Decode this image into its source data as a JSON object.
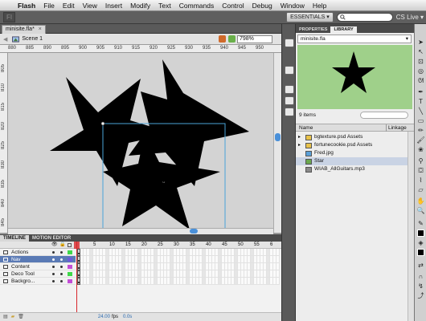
{
  "menubar": {
    "app": "Flash",
    "items": [
      "File",
      "Edit",
      "View",
      "Insert",
      "Modify",
      "Text",
      "Commands",
      "Control",
      "Debug",
      "Window",
      "Help"
    ]
  },
  "apptoolbar": {
    "logo": "Fl",
    "workspace": "ESSENTIALS ▾",
    "search_placeholder": "",
    "cslive": "CS Live ▾"
  },
  "document": {
    "tab": "minisite.fla*",
    "scene": "Scene 1",
    "zoom": "798%"
  },
  "rulers": {
    "h": [
      "880",
      "885",
      "890",
      "895",
      "900",
      "905",
      "910",
      "915",
      "920",
      "925",
      "930",
      "935",
      "940",
      "945",
      "950"
    ],
    "v": [
      "805",
      "810",
      "815",
      "820",
      "825",
      "830",
      "835",
      "840",
      "845"
    ]
  },
  "timeline": {
    "tabs": [
      "TIMELINE",
      "MOTION EDITOR"
    ],
    "frame_numbers": [
      "5",
      "10",
      "15",
      "20",
      "25",
      "30",
      "35",
      "40",
      "45",
      "50",
      "55",
      "6"
    ],
    "layers": [
      {
        "name": "Actions",
        "color": "#3fd84a",
        "selected": false
      },
      {
        "name": "Nav",
        "color": "#6a5bd8",
        "selected": true
      },
      {
        "name": "Content",
        "color": "#c24dd6",
        "selected": false
      },
      {
        "name": "Deco Tool",
        "color": "#3fd84a",
        "selected": false
      },
      {
        "name": "Backgro...",
        "color": "#c24dd6",
        "selected": false
      }
    ],
    "fps": "24.00",
    "fps_label": "fps",
    "time": "0.0s"
  },
  "panel": {
    "tabs": [
      "PROPERTIES",
      "LIBRARY"
    ],
    "library_file": "minisite.fla",
    "item_count": "9 items",
    "col_name": "Name",
    "col_linkage": "Linkage",
    "items": [
      {
        "name": "bgtexture.psd Assets",
        "type": "folder"
      },
      {
        "name": "fortunecookie.psd Assets",
        "type": "folder"
      },
      {
        "name": "Fred.jpg",
        "type": "bitmap"
      },
      {
        "name": "Star",
        "type": "symbol"
      },
      {
        "name": "WIAB_AllGuitars.mp3",
        "type": "sound"
      }
    ]
  }
}
